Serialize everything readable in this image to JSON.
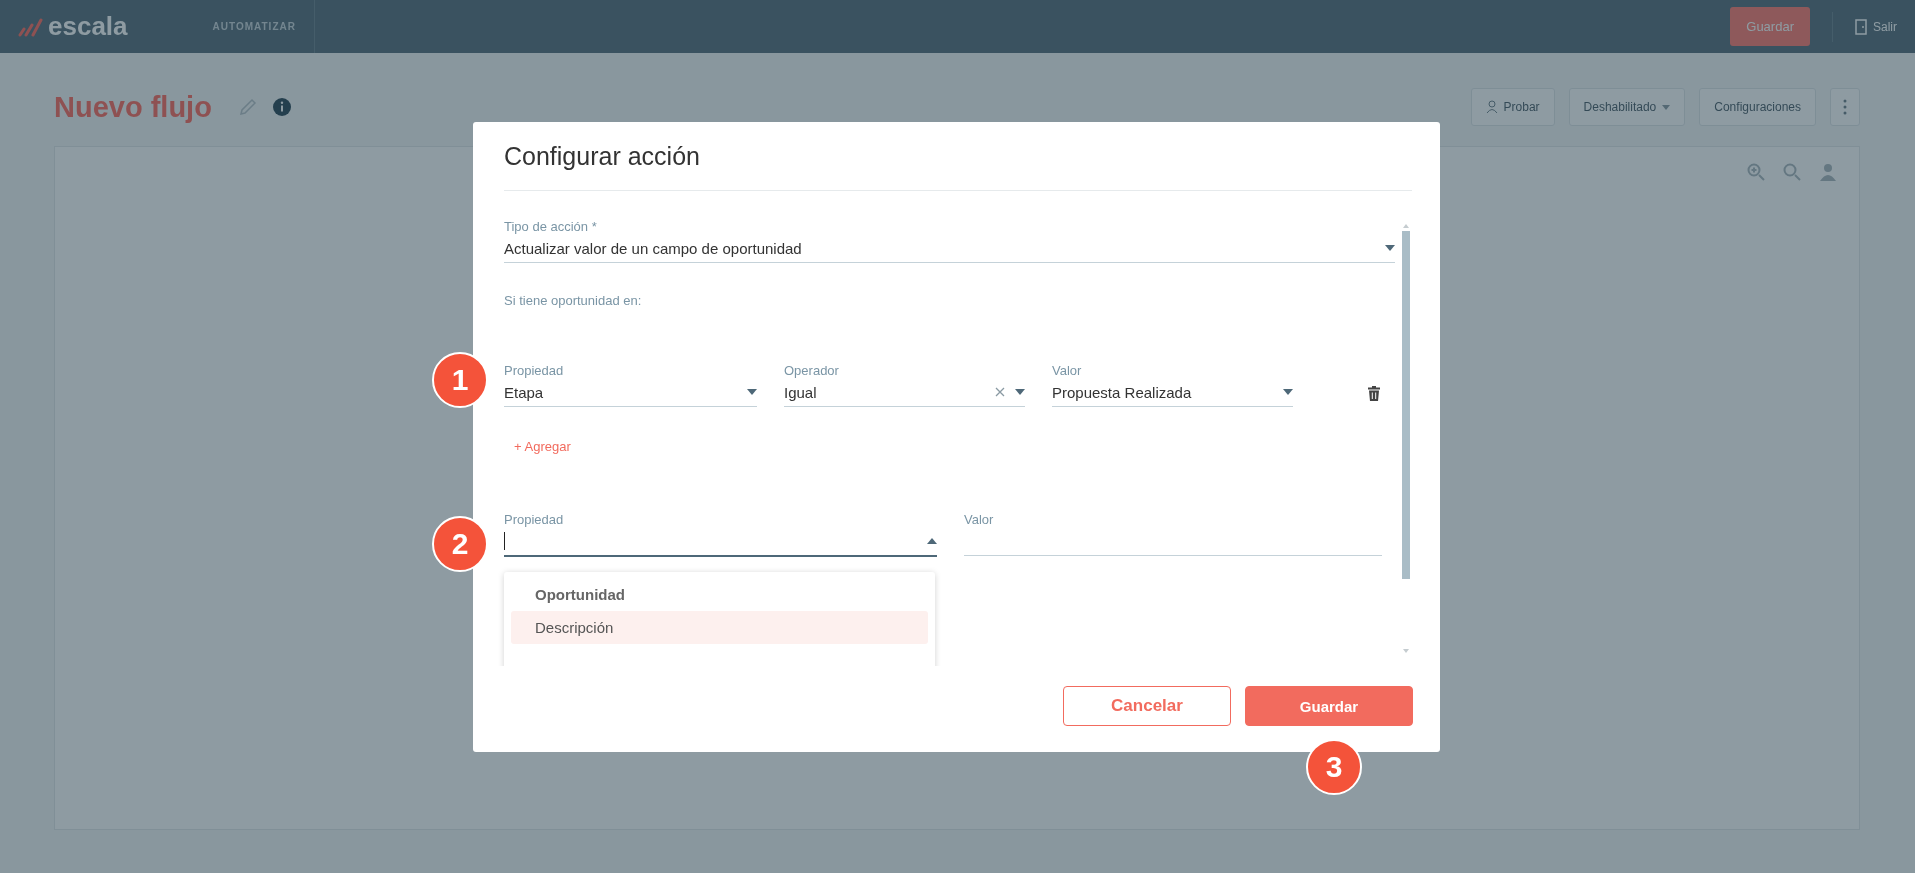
{
  "app_bar": {
    "logo": "escala",
    "section": "AUTOMATIZAR",
    "save_button": "Guardar",
    "exit_label": "Salir"
  },
  "page_header": {
    "title": "Nuevo flujo",
    "actions": [
      {
        "label": "Probar",
        "kind": "icon-button"
      },
      {
        "label": "Deshabilitado",
        "kind": "dropdown"
      },
      {
        "label": "Configuraciones",
        "kind": "button"
      }
    ]
  },
  "dialog": {
    "title": "Configurar acción",
    "action_type": {
      "label": "Tipo de acción *",
      "value": "Actualizar valor de un campo de oportunidad"
    },
    "condition_heading": "Si tiene oportunidad en:",
    "conditions": [
      {
        "fields": [
          {
            "label": "Propiedad",
            "value": "Etapa",
            "clearable": false
          },
          {
            "label": "Operador",
            "value": "Igual",
            "clearable": true
          },
          {
            "label": "Valor",
            "value": "Propuesta Realizada",
            "clearable": false
          }
        ]
      }
    ],
    "add_link": "+ Agregar",
    "update_fields": [
      {
        "label": "Propiedad",
        "kind": "select",
        "open": true
      },
      {
        "label": "Valor",
        "kind": "text",
        "open": false
      }
    ],
    "dropdown": {
      "group": "Oportunidad",
      "options": [
        {
          "label": "Descripción",
          "selected": true
        }
      ]
    },
    "buttons": [
      {
        "label": "Cancelar",
        "kind": "outline"
      },
      {
        "label": "Guardar",
        "kind": "primary"
      }
    ]
  },
  "annotations": [
    {
      "label": "1"
    },
    {
      "label": "2"
    },
    {
      "label": "3"
    }
  ]
}
